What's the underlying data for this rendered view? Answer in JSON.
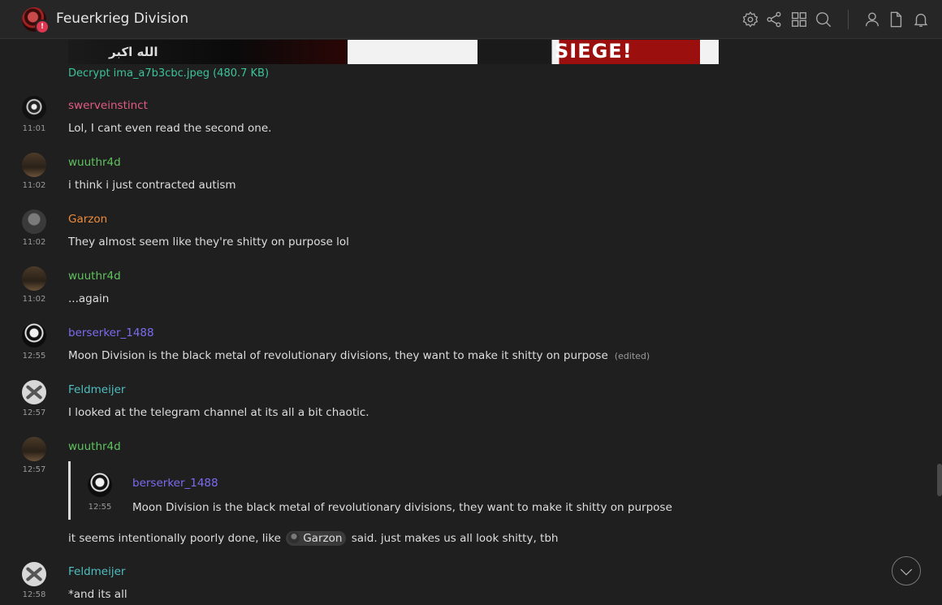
{
  "header": {
    "room_name": "Feuerkrieg Division",
    "room_badge": "!",
    "icons": [
      "settings-icon",
      "share-icon",
      "apps-icon",
      "search-icon",
      "members-icon",
      "files-icon",
      "notifications-icon"
    ]
  },
  "attachment": {
    "image_text_left": "الله اكبر",
    "image_text_right": "SIEGE!",
    "decrypt_label": "Decrypt ima_a7b3cbc.jpeg (480.7 KB)"
  },
  "messages": [
    {
      "sender": "swerveinstinct",
      "time": "11:01",
      "body": "Lol, I cant even read the second one."
    },
    {
      "sender": "wuuthr4d",
      "time": "11:02",
      "body": "i think i just contracted autism"
    },
    {
      "sender": "Garzon",
      "time": "11:02",
      "body": "They almost seem like they're shitty on purpose lol"
    },
    {
      "sender": "wuuthr4d",
      "time": "11:02",
      "body": "...again"
    },
    {
      "sender": "berserker_1488",
      "time": "12:55",
      "body": "Moon Division is the black metal of revolutionary divisions, they want to make it shitty on purpose",
      "edited": "(edited)"
    },
    {
      "sender": "Feldmeijer",
      "time": "12:57",
      "body": "I looked at the telegram channel at its all a bit chaotic."
    },
    {
      "sender": "wuuthr4d",
      "time": "12:57",
      "quote": {
        "sender": "berserker_1488",
        "time": "12:55",
        "body": "Moon Division is the black metal of revolutionary divisions, they want to make it shitty on purpose"
      },
      "body_before": "it seems intentionally poorly done, like",
      "mention": "Garzon",
      "body_after": "said. just makes us all look shitty, tbh"
    },
    {
      "sender": "Feldmeijer",
      "time": "12:58",
      "body": "*and its all"
    }
  ]
}
